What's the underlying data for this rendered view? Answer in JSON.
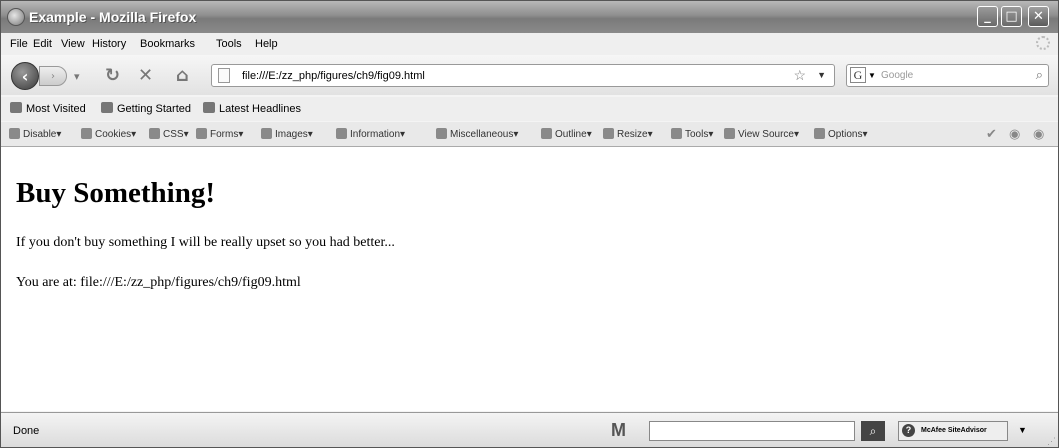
{
  "window": {
    "title": "Example - Mozilla Firefox",
    "min_glyph": "_",
    "max_glyph": "□",
    "close_glyph": "✕"
  },
  "menu": [
    "File",
    "Edit",
    "View",
    "History",
    "Bookmarks",
    "Tools",
    "Help"
  ],
  "nav": {
    "back_glyph": "‹",
    "forward_glyph": "›",
    "url": "file:///E:/zz_php/figures/ch9/fig09.html",
    "search_placeholder": "Google",
    "search_engine_glyph": "G"
  },
  "bookmarks": [
    "Most Visited",
    "Getting Started",
    "Latest Headlines"
  ],
  "devtoolbar": [
    "Disable",
    "Cookies",
    "CSS",
    "Forms",
    "Images",
    "Information",
    "Miscellaneous",
    "Outline",
    "Resize",
    "Tools",
    "View Source",
    "Options"
  ],
  "content": {
    "heading": "Buy Something!",
    "paragraph": "If you don't buy something I will be really upset so you had better...",
    "location_text": "You are at: file:///E:/zz_php/figures/ch9/fig09.html"
  },
  "status": {
    "text": "Done",
    "m_label": "M",
    "mcafee_label": "McAfee SiteAdvisor"
  }
}
